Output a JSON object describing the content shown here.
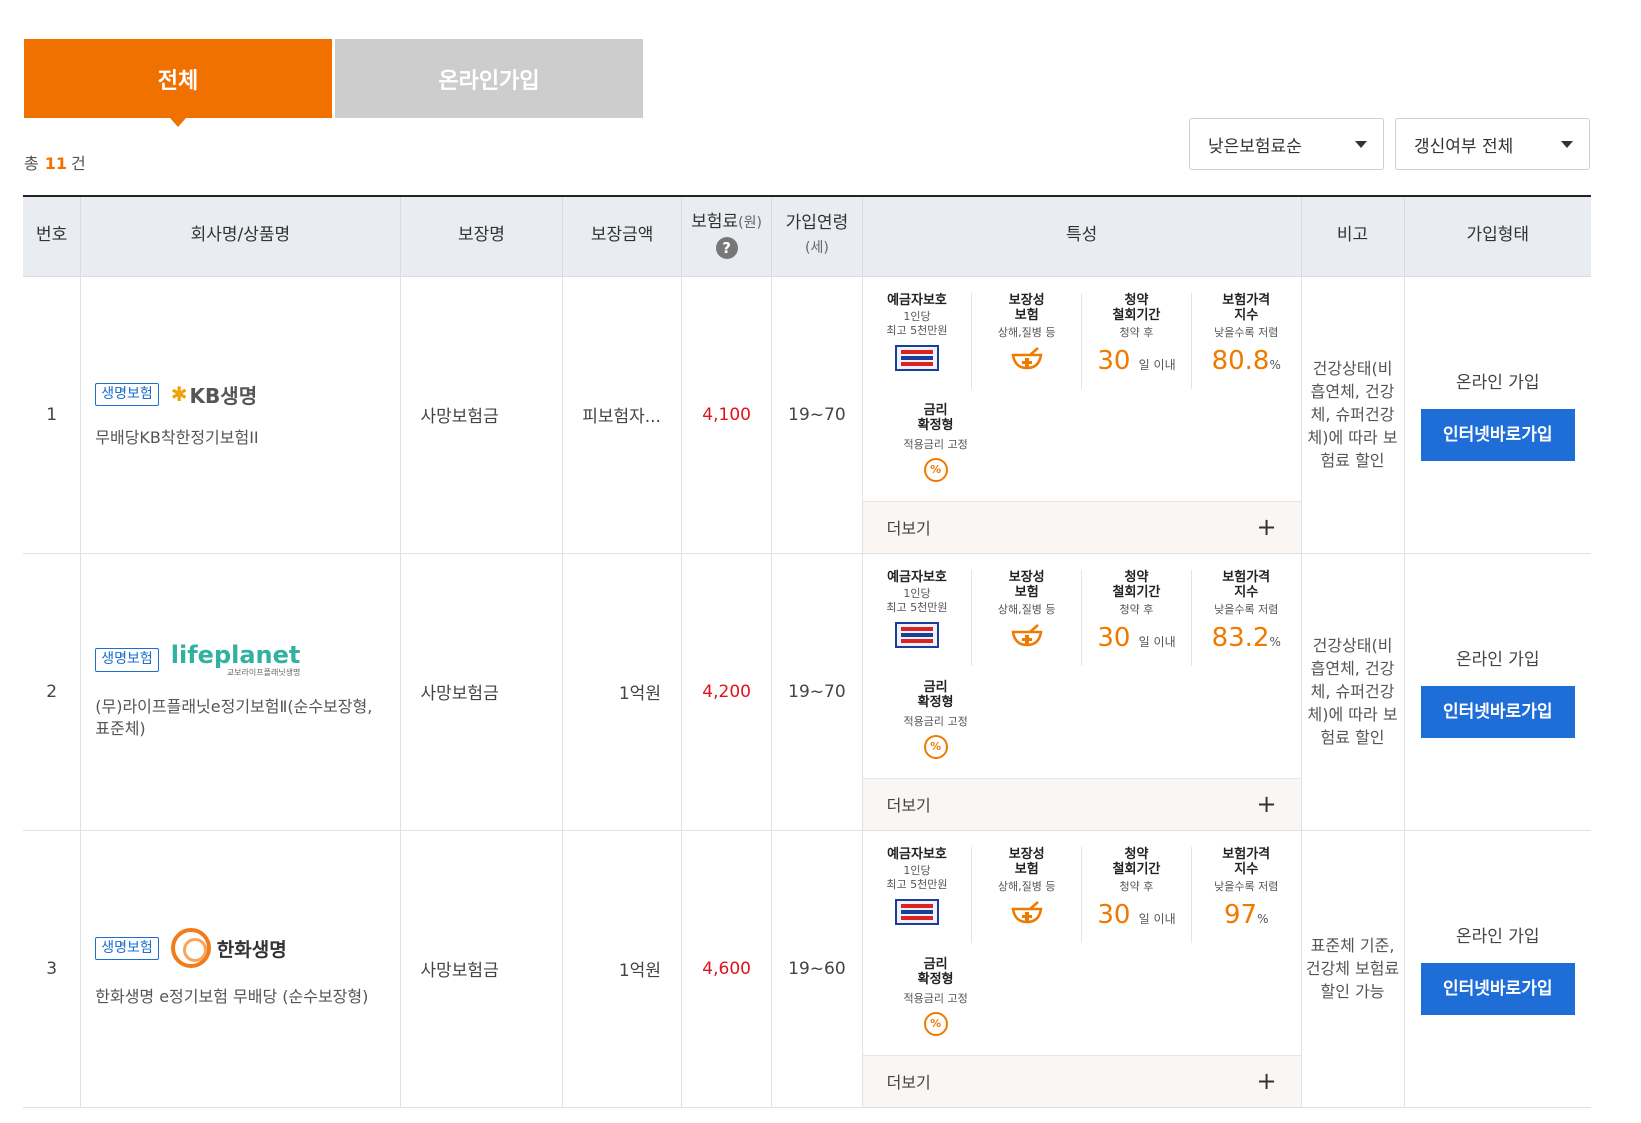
{
  "tabs": [
    {
      "label": "전체",
      "active": true
    },
    {
      "label": "온라인가입",
      "active": false
    }
  ],
  "count": {
    "prefix": "총",
    "value": "11",
    "suffix": "건"
  },
  "filters": {
    "sort": "낮은보험료순",
    "renew": "갱신여부 전체"
  },
  "headers": {
    "num": "번호",
    "company": "회사명/상품명",
    "coverage_name": "보장명",
    "coverage_amount": "보장금액",
    "premium": "보험료",
    "premium_unit": "(원)",
    "premium_help": "?",
    "age": "가입연령",
    "age_unit": "(세)",
    "features": "특성",
    "note": "비고",
    "join_type": "가입형태"
  },
  "colors": {
    "accent": "#f07100",
    "tab_inactive": "#cdcdcd",
    "join_button": "#1f6ed7",
    "premium_text": "#e0121b",
    "badge": "#1a6fd0"
  },
  "feature_labels": {
    "deposit_title": "예금자보호",
    "deposit_sub1": "1인당",
    "deposit_sub2": "최고 5천만원",
    "coverage_title1": "보장성",
    "coverage_title2": "보험",
    "coverage_sub": "상해,질병 등",
    "withdraw_title1": "청약",
    "withdraw_title2": "철회기간",
    "withdraw_sub": "청약 후",
    "withdraw_value": "30",
    "withdraw_unit": "일 이내",
    "price_title1": "보험가격",
    "price_title2": "지수",
    "price_sub": "낮을수록 저렴",
    "rate_title1": "금리",
    "rate_title2": "확정형",
    "rate_sub": "적용금리 고정",
    "more": "더보기",
    "more_icon": "+"
  },
  "rows": [
    {
      "num": "1",
      "category": "생명보험",
      "logo": "KB생명",
      "logo_mark": "✱",
      "product": "무배당KB착한정기보험II",
      "coverage_name": "사망보험금",
      "coverage_amount": "피보험자...",
      "premium": "4,100",
      "age": "19~70",
      "price_index": "80.8",
      "price_unit": "%",
      "note": "건강상태(비흡연체, 건강체, 슈퍼건강체)에 따라 보험료 할인",
      "join_label": "온라인 가입",
      "join_button": "인터넷바로가입"
    },
    {
      "num": "2",
      "category": "생명보험",
      "logo": "lifeplanet",
      "logo_sub": "교보라이프플래닛생명",
      "product": "(무)라이프플래닛e정기보험Ⅱ(순수보장형, 표준체)",
      "coverage_name": "사망보험금",
      "coverage_amount": "1억원",
      "premium": "4,200",
      "age": "19~70",
      "price_index": "83.2",
      "price_unit": "%",
      "note": "건강상태(비흡연체, 건강체, 슈퍼건강체)에 따라 보험료 할인",
      "join_label": "온라인 가입",
      "join_button": "인터넷바로가입"
    },
    {
      "num": "3",
      "category": "생명보험",
      "logo": "한화생명",
      "product": "한화생명 e정기보험 무배당 (순수보장형)",
      "coverage_name": "사망보험금",
      "coverage_amount": "1억원",
      "premium": "4,600",
      "age": "19~60",
      "price_index": "97",
      "price_unit": "%",
      "note": "표준체 기준, 건강체 보험료 할인 가능",
      "join_label": "온라인 가입",
      "join_button": "인터넷바로가입"
    }
  ]
}
